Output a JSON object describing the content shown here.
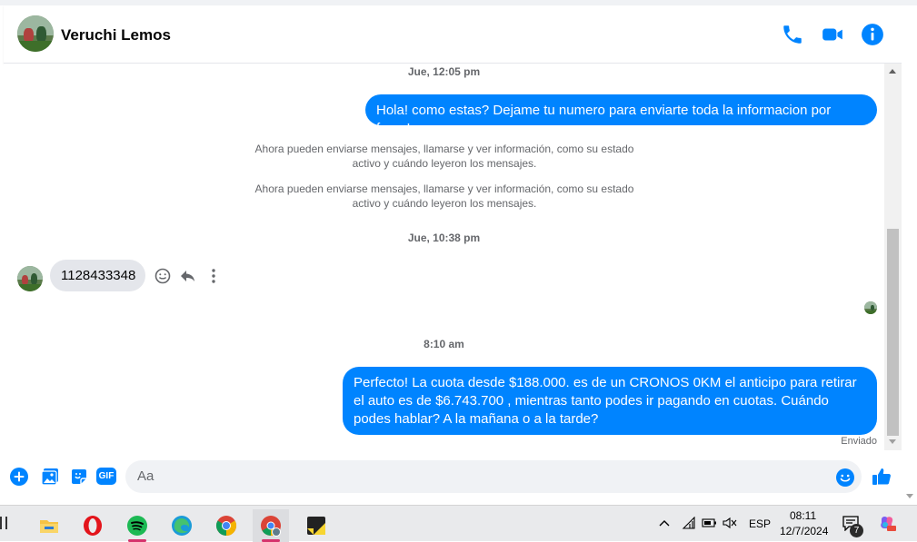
{
  "header": {
    "contact_name": "Veruchi Lemos",
    "icons": [
      "phone-icon",
      "video-call-icon",
      "info-icon"
    ]
  },
  "colors": {
    "accent": "#0084ff",
    "incoming_bubble": "#e4e6eb",
    "muted_text": "#65676b"
  },
  "chat": {
    "timestamp_1": "Jue, 12:05 pm",
    "outgoing_1": "Hola! como estas? Dejame tu numero para enviarte toda la informacion por favor!",
    "system_1": "Ahora pueden enviarse mensajes, llamarse y ver información, como su estado activo y cuándo leyeron los mensajes.",
    "system_2": "Ahora pueden enviarse mensajes, llamarse y ver información, como su estado activo y cuándo leyeron los mensajes.",
    "timestamp_2": "Jue, 10:38 pm",
    "incoming_1": "1128433348",
    "timestamp_3": "8:10 am",
    "outgoing_2": "Perfecto! La cuota desde $188.000. es de un CRONOS 0KM el anticipo para retirar el auto es de $6.743.700 , mientras tanto podes ir pagando en cuotas. Cuándo podes hablar? A la mañana o a la tarde?",
    "status": "Enviado"
  },
  "composer": {
    "placeholder": "Aa",
    "icons": [
      "plus-icon",
      "photo-icon",
      "sticker-icon",
      "gif-icon",
      "emoji-icon",
      "thumbs-up-icon"
    ],
    "gif_label": "GIF"
  },
  "taskbar": {
    "apps": [
      "file-explorer",
      "opera",
      "spotify",
      "edge",
      "chrome",
      "chrome-profile",
      "sticky-notes"
    ],
    "language": "ESP",
    "time": "08:11",
    "date": "12/7/2024",
    "notification_count": "7"
  }
}
